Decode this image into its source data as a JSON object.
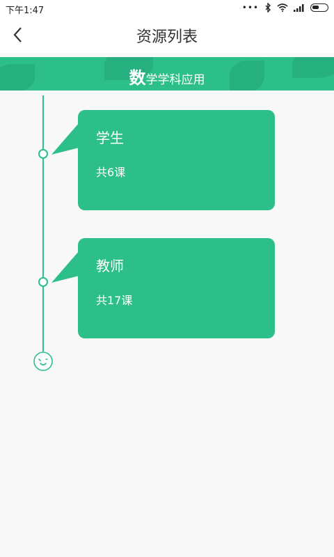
{
  "status_bar": {
    "time": "下午1:47",
    "icons": [
      "dots-icon",
      "bluetooth-icon",
      "wifi-icon",
      "signal-icon",
      "battery-icon"
    ]
  },
  "header": {
    "title": "资源列表",
    "back_icon": "chevron-left-icon"
  },
  "banner": {
    "lead_char": "数",
    "rest_text": "学学科应用",
    "color": "#2dbf8a"
  },
  "timeline": {
    "items": [
      {
        "name": "学生",
        "count": "共6课"
      },
      {
        "name": "教师",
        "count": "共17课"
      }
    ],
    "end_icon": "smiley-face-icon"
  },
  "colors": {
    "accent": "#2dbf8a",
    "background": "#f8f8f8"
  }
}
